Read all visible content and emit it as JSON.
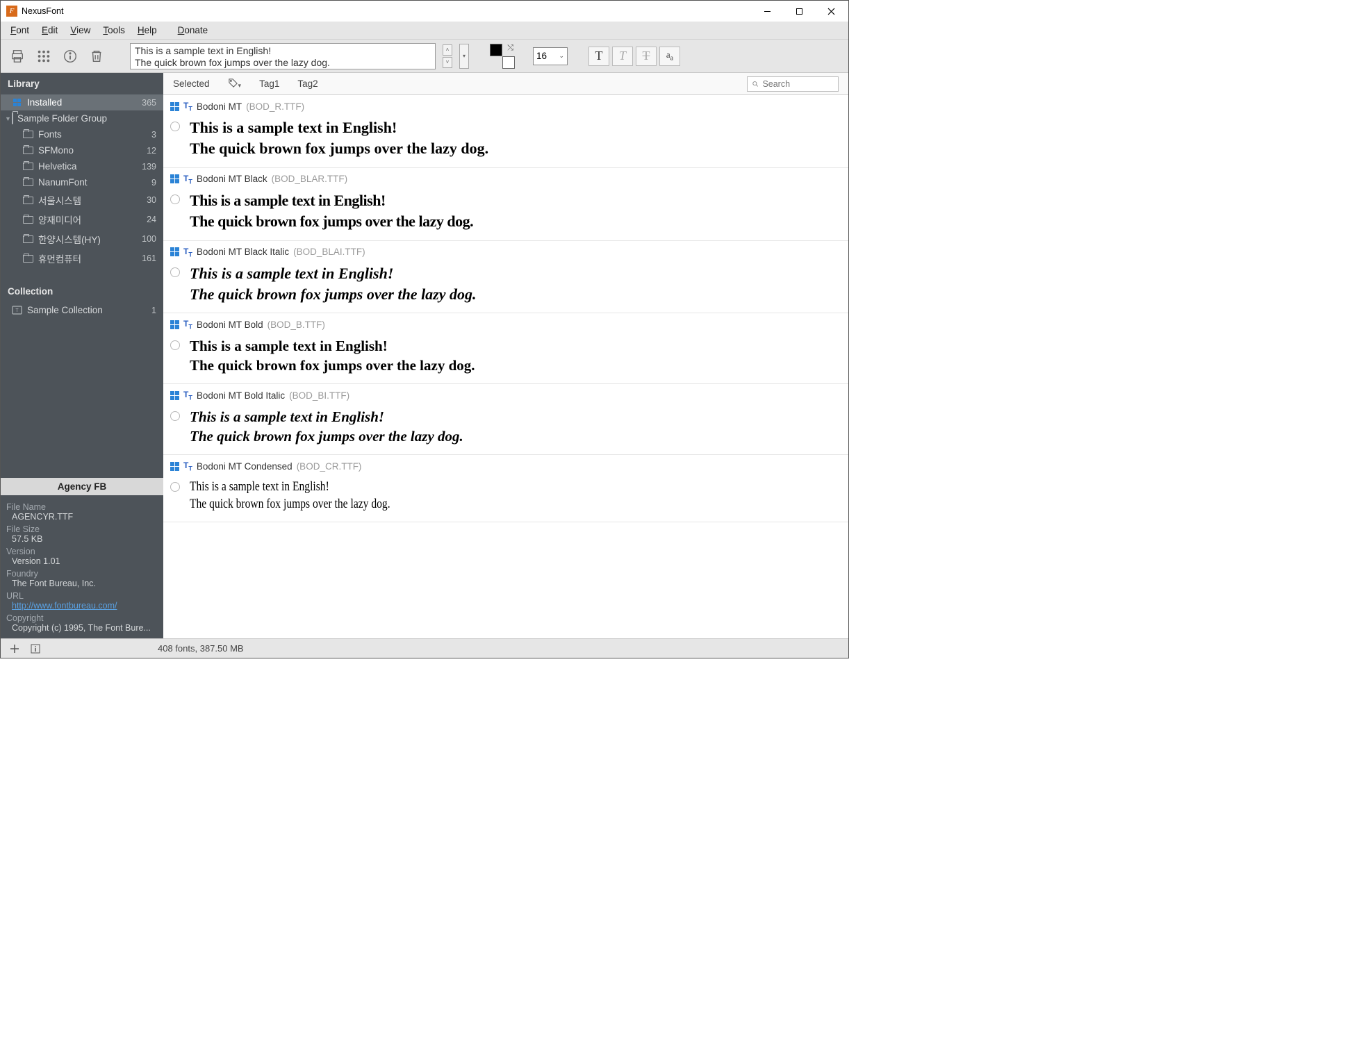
{
  "app": {
    "title": "NexusFont"
  },
  "menu": {
    "font": "Font",
    "edit": "Edit",
    "view": "View",
    "tools": "Tools",
    "help": "Help",
    "donate": "Donate"
  },
  "toolbar": {
    "sample_text": "This is a sample text in English!\nThe quick brown fox jumps over the lazy dog.",
    "font_size": "16"
  },
  "tagbar": {
    "selected": "Selected",
    "tag1": "Tag1",
    "tag2": "Tag2",
    "search_placeholder": "Search"
  },
  "sidebar": {
    "library_label": "Library",
    "installed": {
      "label": "Installed",
      "count": "365"
    },
    "group_label": "Sample Folder Group",
    "folders": [
      {
        "label": "Fonts",
        "count": "3"
      },
      {
        "label": "SFMono",
        "count": "12"
      },
      {
        "label": "Helvetica",
        "count": "139"
      },
      {
        "label": "NanumFont",
        "count": "9"
      },
      {
        "label": "서울시스템",
        "count": "30"
      },
      {
        "label": "양재미디어",
        "count": "24"
      },
      {
        "label": "한양시스템(HY)",
        "count": "100"
      },
      {
        "label": "휴먼컴퓨터",
        "count": "161"
      }
    ],
    "collection_label": "Collection",
    "collections": [
      {
        "label": "Sample Collection",
        "count": "1"
      }
    ],
    "info": {
      "title": "Agency FB",
      "file_name_k": "File Name",
      "file_name_v": "AGENCYR.TTF",
      "file_size_k": "File Size",
      "file_size_v": "57.5 KB",
      "version_k": "Version",
      "version_v": "Version 1.01",
      "foundry_k": "Foundry",
      "foundry_v": "The Font Bureau, Inc.",
      "url_k": "URL",
      "url_v": "http://www.fontbureau.com/",
      "copyright_k": "Copyright",
      "copyright_v": "Copyright (c) 1995, The Font Bure..."
    }
  },
  "sample_line1": "This is a sample text in English!",
  "sample_line2": "The quick brown fox jumps over the lazy dog.",
  "fonts": [
    {
      "name": "Bodoni MT",
      "file": "(BOD_R.TTF)",
      "class": "f-bodoni"
    },
    {
      "name": "Bodoni MT Black",
      "file": "(BOD_BLAR.TTF)",
      "class": "f-bodoni-black"
    },
    {
      "name": "Bodoni MT Black Italic",
      "file": "(BOD_BLAI.TTF)",
      "class": "f-bodoni-black-italic"
    },
    {
      "name": "Bodoni MT Bold",
      "file": "(BOD_B.TTF)",
      "class": "f-bodoni-bold"
    },
    {
      "name": "Bodoni MT Bold Italic",
      "file": "(BOD_BI.TTF)",
      "class": "f-bodoni-bold-italic"
    },
    {
      "name": "Bodoni MT Condensed",
      "file": "(BOD_CR.TTF)",
      "class": "f-bodoni-cond"
    }
  ],
  "status": {
    "text": "408 fonts, 387.50 MB"
  }
}
